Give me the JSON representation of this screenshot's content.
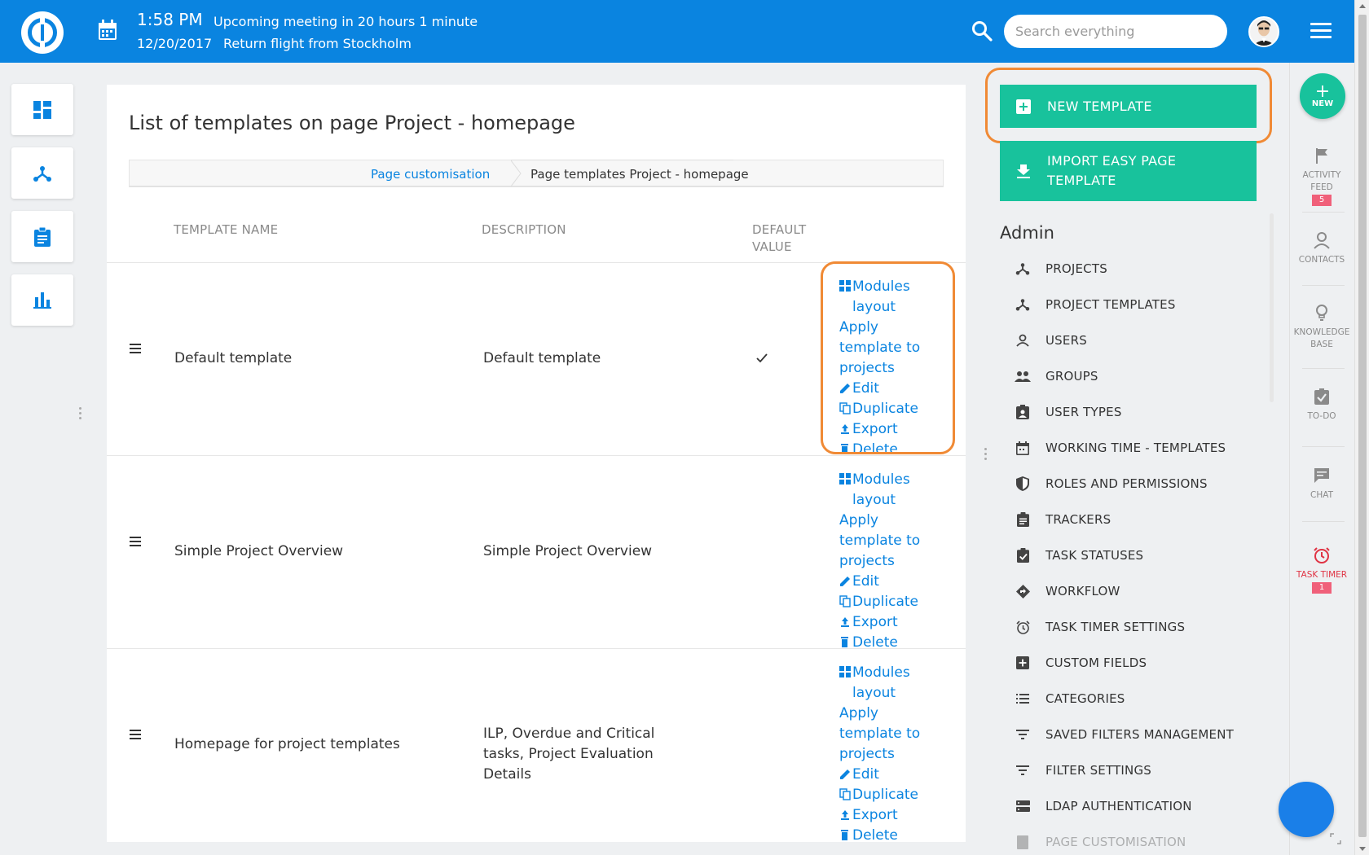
{
  "header": {
    "time": "1:58 PM",
    "date": "12/20/2017",
    "meeting": "Upcoming meeting in 20 hours 1 minute",
    "flight": "Return flight from Stockholm",
    "search_placeholder": "Search everything"
  },
  "page": {
    "title": "List of templates on page Project - homepage",
    "breadcrumb_link": "Page customisation",
    "breadcrumb_current": "Page templates Project - homepage"
  },
  "table": {
    "col_name": "TEMPLATE NAME",
    "col_description": "DESCRIPTION",
    "col_default": "DEFAULT VALUE",
    "actions": {
      "modules_layout": "Modules layout",
      "apply_template": "Apply template to projects",
      "edit": "Edit",
      "duplicate": "Duplicate",
      "export": "Export",
      "delete": "Delete"
    },
    "rows": [
      {
        "name": "Default template",
        "description": "Default template",
        "default": "✓"
      },
      {
        "name": "Simple Project Overview",
        "description": "Simple Project Overview",
        "default": ""
      },
      {
        "name": "Homepage for project templates",
        "description": "ILP, Overdue and Critical tasks, Project Evaluation Details",
        "default": ""
      }
    ]
  },
  "admin": {
    "new_template": "NEW TEMPLATE",
    "import_template": "IMPORT EASY PAGE TEMPLATE",
    "title": "Admin",
    "items": [
      {
        "label": "PROJECTS",
        "icon": "project-tree-icon"
      },
      {
        "label": "PROJECT TEMPLATES",
        "icon": "project-tree-icon"
      },
      {
        "label": "USERS",
        "icon": "user-icon"
      },
      {
        "label": "GROUPS",
        "icon": "group-icon"
      },
      {
        "label": "USER TYPES",
        "icon": "badge-icon"
      },
      {
        "label": "WORKING TIME - TEMPLATES",
        "icon": "calendar-icon"
      },
      {
        "label": "ROLES AND PERMISSIONS",
        "icon": "shield-icon"
      },
      {
        "label": "TRACKERS",
        "icon": "clipboard-icon"
      },
      {
        "label": "TASK STATUSES",
        "icon": "clipboard-check-icon"
      },
      {
        "label": "WORKFLOW",
        "icon": "workflow-icon"
      },
      {
        "label": "TASK TIMER SETTINGS",
        "icon": "alarm-icon"
      },
      {
        "label": "CUSTOM FIELDS",
        "icon": "plus-box-icon"
      },
      {
        "label": "CATEGORIES",
        "icon": "list-icon"
      },
      {
        "label": "SAVED FILTERS MANAGEMENT",
        "icon": "filter-icon"
      },
      {
        "label": "FILTER SETTINGS",
        "icon": "filter-icon"
      },
      {
        "label": "LDAP AUTHENTICATION",
        "icon": "server-icon"
      },
      {
        "label": "PAGE CUSTOMISATION",
        "icon": "page-icon"
      }
    ]
  },
  "rail": {
    "new": "NEW",
    "activity_feed": "ACTIVITY FEED",
    "activity_badge": "5",
    "contacts": "CONTACTS",
    "knowledge_base": "KNOWLEDGE BASE",
    "todo": "TO-DO",
    "chat": "CHAT",
    "task_timer": "TASK TIMER",
    "task_timer_badge": "1"
  },
  "colors": {
    "header_blue": "#0a84e0",
    "accent_green": "#18c29c",
    "highlight_orange": "#f08a35",
    "badge_red": "#f0607a"
  }
}
